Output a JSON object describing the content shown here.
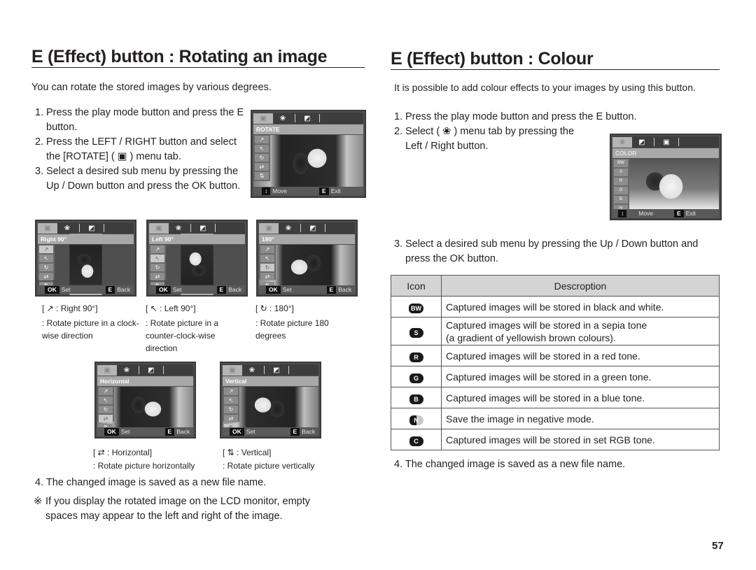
{
  "left": {
    "title": "E (Effect) button : Rotating an image",
    "intro": "You can rotate the stored images by various degrees.",
    "steps": [
      {
        "num": "1.",
        "text": "Press the play mode button and press the E button."
      },
      {
        "num": "2.",
        "text": "Press the LEFT / RIGHT button and select the [ROTATE] ( ▣ ) menu tab."
      },
      {
        "num": "3.",
        "text": "Select a desired sub menu by pressing the Up / Down button and press the OK button."
      }
    ],
    "main_screen": {
      "menu_title": "ROTATE",
      "tabs": [
        "▣",
        "❀",
        "◩"
      ],
      "side_items": [
        "↗",
        "↖",
        "↻",
        "⇄",
        "⇅"
      ],
      "bottom_left_key": "↕",
      "bottom_left_label": "Move",
      "bottom_right_key": "E",
      "bottom_right_label": "Exit"
    },
    "options": [
      {
        "menu_title": "Right 90°",
        "icon": "↗",
        "label": "[ ↗ : Right 90°]",
        "desc": ": Rotate picture in a clock-wise direction",
        "selected": 0
      },
      {
        "menu_title": "Left 90°",
        "icon": "↖",
        "label": "[ ↖ :  Left 90°]",
        "desc": ":  Rotate picture in a counter-clock-wise direction",
        "selected": 1
      },
      {
        "menu_title": "180°",
        "icon": "↻",
        "label": "[ ↻ :  180°]",
        "desc": ": Rotate picture 180 degrees",
        "selected": 2
      },
      {
        "menu_title": "Horizontal",
        "icon": "⇄",
        "label": "[ ⇄ :  Horizontal]",
        "desc": ": Rotate picture horizontally",
        "selected": 3
      },
      {
        "menu_title": "Vertical",
        "icon": "⇅",
        "label": "[ ⇅ :  Vertical]",
        "desc": ": Rotate picture vertically",
        "selected": 4
      }
    ],
    "sub_bottom": {
      "ok_key": "OK",
      "ok_label": "Set",
      "e_key": "E",
      "e_label": "Back"
    },
    "step4": "4. The changed image is saved as a new file name.",
    "note_mark": "※",
    "note": "If you display the rotated image on the LCD monitor, empty spaces may appear to the left and right of the image."
  },
  "right": {
    "title": "E (Effect) button : Colour",
    "intro": "It is possible to add colour effects to your images by using this button.",
    "steps": [
      {
        "num": "1.",
        "text": "Press the play mode button and press the E button."
      },
      {
        "num": "2.",
        "text": "Select ( ❀ ) menu tab by pressing the Left / Right button."
      },
      {
        "num": "3.",
        "text": "Select a desired sub menu by pressing the Up / Down button and press the OK button."
      }
    ],
    "screen": {
      "menu_title": "COLOR",
      "tabs": [
        "❀",
        "◩",
        "▣"
      ],
      "side_items": [
        "BW",
        "S",
        "R",
        "G",
        "B",
        "N"
      ],
      "bottom_left_key": "↕",
      "bottom_left_label": "Move",
      "bottom_right_key": "E",
      "bottom_right_label": "Exit"
    },
    "table": {
      "headers": [
        "Icon",
        "Descroption"
      ],
      "rows": [
        {
          "icon": "BW",
          "desc": "Captured images will be stored in black and white."
        },
        {
          "icon": "S",
          "desc": "Captured images will be stored in a sepia tone",
          "desc2": "(a gradient of yellowish brown colours)."
        },
        {
          "icon": "R",
          "desc": "Captured images will be stored in a red tone."
        },
        {
          "icon": "G",
          "desc": "Captured images will be stored in a green tone."
        },
        {
          "icon": "B",
          "desc": "Captured images will be stored in a blue tone."
        },
        {
          "icon": "N",
          "desc": "Save the image in negative mode."
        },
        {
          "icon": "C",
          "desc": "Captured images will be stored in set RGB tone."
        }
      ]
    },
    "step4": "4. The changed image is saved as a new file name."
  },
  "page_number": "57"
}
